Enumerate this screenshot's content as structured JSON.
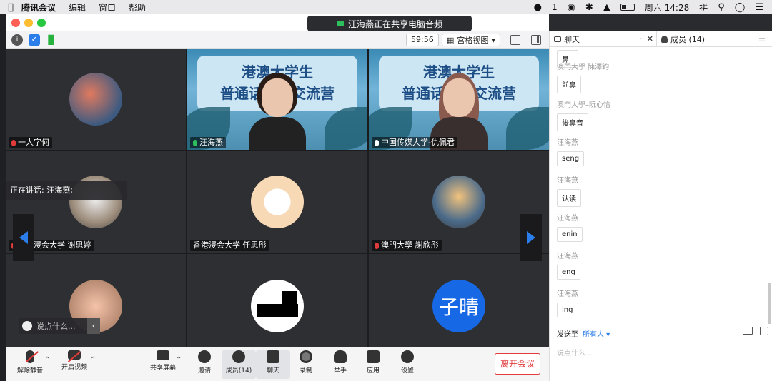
{
  "menubar": {
    "app_name": "腾讯会议",
    "items": [
      "编辑",
      "窗口",
      "帮助"
    ],
    "right": {
      "wechat_count": "1",
      "datetime": "周六 14:28",
      "input_method": "拼"
    }
  },
  "window": {
    "share_banner": "汪海燕正在共享电脑音频",
    "timer": "59:56",
    "view_label": "宫格视图"
  },
  "speaking_label": "正在讲话: 汪海燕;",
  "chat_popup_placeholder": "说点什么...",
  "tiles": [
    {
      "name": "一人字何",
      "muted": true
    },
    {
      "name": "汪海燕",
      "muted": false,
      "banner": "港澳大学生\n普通话培训交流营"
    },
    {
      "name": "中国传媒大学-仇佩君",
      "muted": false,
      "banner": "港澳大学生\n普通话培训交流营"
    },
    {
      "name": "香港浸会大学 谢思婷",
      "muted": true
    },
    {
      "name": "香港浸会大学 任思彤",
      "muted": false
    },
    {
      "name": "澳門大學 謝欣彤",
      "muted": true
    },
    {
      "name": "",
      "muted": true
    },
    {
      "name": "",
      "muted": true
    },
    {
      "name": "",
      "muted": true,
      "initials": "子晴"
    }
  ],
  "toolbar": {
    "unmute": "解除静音",
    "video": "开启视频",
    "share": "共享屏幕",
    "invite": "邀请",
    "members": "成员(14)",
    "chat": "聊天",
    "record": "录制",
    "raise_hand": "举手",
    "apps": "应用",
    "settings": "设置",
    "leave": "离开会议"
  },
  "panel": {
    "chat_tab": "聊天",
    "members_tab": "成员 (14)",
    "messages": [
      {
        "sender": "",
        "text": "鼻"
      },
      {
        "sender": "澳門大學 陳澤鈞",
        "text": "前鼻"
      },
      {
        "sender": "澳門大學–阮心怡",
        "text": "後鼻音"
      },
      {
        "sender": "汪海燕",
        "text": "seng"
      },
      {
        "sender": "汪海燕",
        "text": "认读"
      },
      {
        "sender": "汪海燕",
        "text": "enin"
      },
      {
        "sender": "汪海燕",
        "text": "eng"
      },
      {
        "sender": "汪海燕",
        "text": "ing"
      }
    ],
    "send_to_label": "发送至",
    "send_to_target": "所有人",
    "input_placeholder": "说点什么..."
  }
}
